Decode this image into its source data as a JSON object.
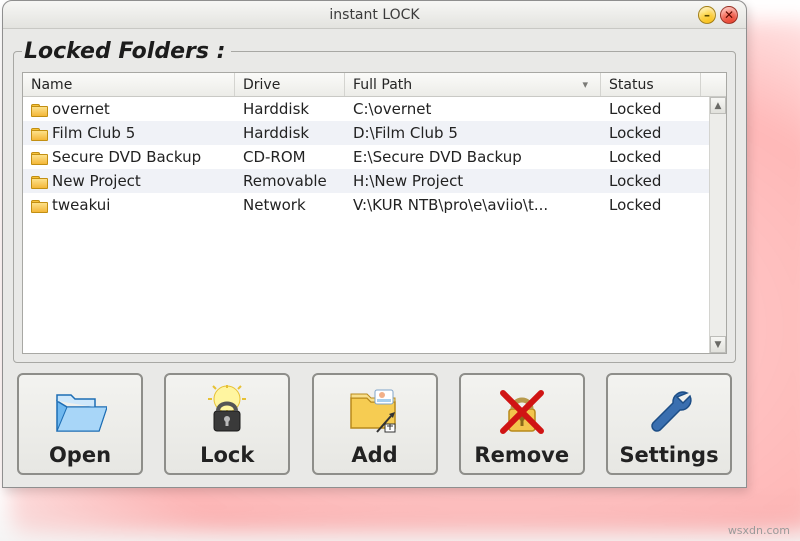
{
  "window": {
    "title": "instant LOCK"
  },
  "group": {
    "legend": "Locked Folders :"
  },
  "columns": {
    "name": "Name",
    "drive": "Drive",
    "path": "Full Path",
    "status": "Status"
  },
  "rows": [
    {
      "name": "overnet",
      "drive": "Harddisk",
      "path": "C:\\overnet",
      "status": "Locked"
    },
    {
      "name": "Film Club 5",
      "drive": "Harddisk",
      "path": "D:\\Film Club 5",
      "status": "Locked"
    },
    {
      "name": "Secure DVD Backup",
      "drive": "CD-ROM",
      "path": "E:\\Secure DVD Backup",
      "status": "Locked"
    },
    {
      "name": "New Project",
      "drive": "Removable",
      "path": "H:\\New Project",
      "status": "Locked"
    },
    {
      "name": "tweakui",
      "drive": "Network",
      "path": "V:\\KUR NTB\\pro\\e\\aviio\\t...",
      "status": "Locked"
    }
  ],
  "buttons": {
    "open": "Open",
    "lock": "Lock",
    "add": "Add",
    "remove": "Remove",
    "settings": "Settings"
  },
  "watermark": "wsxdn.com"
}
